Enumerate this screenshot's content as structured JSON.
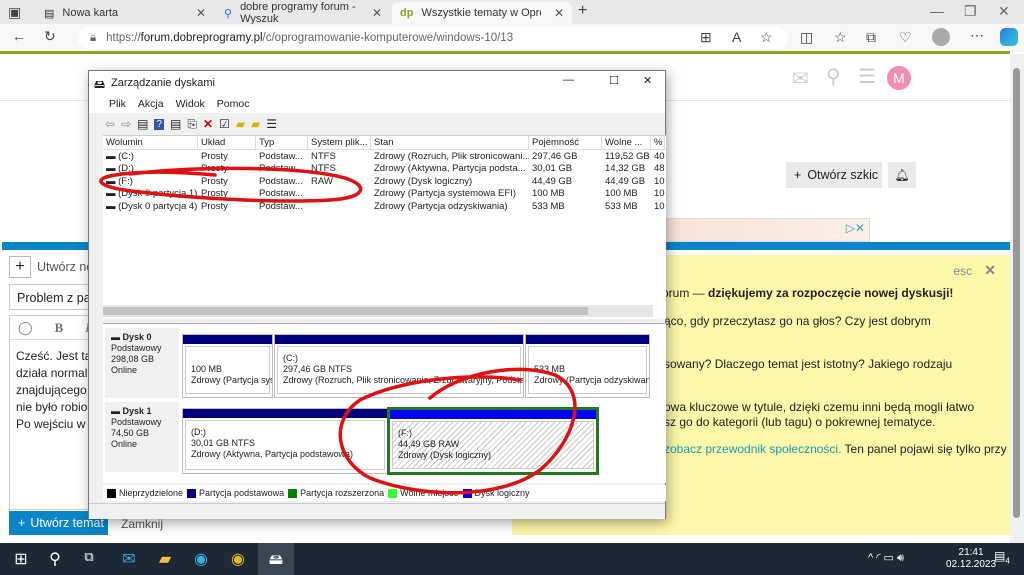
{
  "browser": {
    "tabs": [
      {
        "label": "Nowa karta",
        "icon": "newtab-icon"
      },
      {
        "label": "dobre programy forum - Wyszuk",
        "icon": "search-icon"
      },
      {
        "label": "Wszystkie tematy w Oprogramow",
        "icon": "dp-logo",
        "logo_text": "dp"
      }
    ],
    "url_prefix": "https://",
    "url_domain": "forum.dobreprogramy.pl",
    "url_path": "/c/oprogramowanie-komputerowe/windows-10/13",
    "accent": "#8fa41a"
  },
  "forum": {
    "avatar_letter": "M",
    "draft_button": "Otwórz szkic",
    "composer": {
      "new_topic_label": "Utwórz nowy",
      "title_value": "Problem z partyc",
      "body_lines": [
        "Cześć. Jest taki p",
        "działa normalnie,",
        "znajdującego się",
        "nie było robione.",
        "Po wejściu w zar"
      ],
      "create_button": "Utwórz temat",
      "close_button": "Zamknij"
    },
    "tips": {
      "esc": "esc",
      "line1_pre": "orum — ",
      "line1_bold": "dziękujemy za rozpoczęcie nowej dyskusji!",
      "line2": "ąco, gdy przeczytasz go na głos? Czy jest dobrym",
      "line3": "sowany? Dlaczego temat jest istotny? Jakiego rodzaju",
      "line4": "owa kluczowe w tytule, dzięki czemu inni będą mogli łatwo",
      "line5": "sz go do kategorii (lub tagu) o pokrewnej tematyce.",
      "line6_link": "zobacz przewodnik społeczności.",
      "line6_rest": " Ten panel pojawi się tylko przy",
      "bg": "#fcf8a9"
    }
  },
  "diskmgmt": {
    "title": "Zarządzanie dyskami",
    "menu": [
      "Plik",
      "Akcja",
      "Widok",
      "Pomoc"
    ],
    "columns": [
      "Wolumin",
      "Układ",
      "Typ",
      "System plik...",
      "Stan",
      "Pojemność",
      "Wolne ...",
      "%"
    ],
    "rows": [
      [
        "(C:)",
        "Prosty",
        "Podstaw...",
        "NTFS",
        "Zdrowy (Rozruch, Plik stronicowani...",
        "297,46 GB",
        "119,52 GB",
        "40"
      ],
      [
        "(D:)",
        "Prosty",
        "Podstaw...",
        "NTFS",
        "Zdrowy (Aktywna, Partycja podsta...",
        "30,01 GB",
        "14,32 GB",
        "48"
      ],
      [
        "(F:)",
        "Prosty",
        "Podstaw...",
        "RAW",
        "Zdrowy (Dysk logiczny)",
        "44,49 GB",
        "44,49 GB",
        "10"
      ],
      [
        "(Dysk 0 partycja 1)",
        "Prosty",
        "Podstaw...",
        "",
        "Zdrowy (Partycja systemowa EFI)",
        "100 MB",
        "100 MB",
        "10"
      ],
      [
        "(Dysk 0 partycja 4)",
        "Prosty",
        "Podstaw...",
        "",
        "Zdrowy (Partycja odzyskiwania)",
        "533 MB",
        "533 MB",
        "10"
      ]
    ],
    "disks": [
      {
        "name": "Dysk 0",
        "type": "Podstawowy",
        "size": "298,08 GB",
        "status": "Online",
        "parts": [
          {
            "l1": "",
            "l2": "100 MB",
            "l3": "Zdrowy (Partycja sys"
          },
          {
            "l1": "(C:)",
            "l2": "297,46 GB NTFS",
            "l3": "Zdrowy (Rozruch, Plik stronicowania, Zrzut awaryjny, Podsta"
          },
          {
            "l1": "",
            "l2": "533 MB",
            "l3": "Zdrowy (Partycja odzyskiwan"
          }
        ]
      },
      {
        "name": "Dysk 1",
        "type": "Podstawowy",
        "size": "74,50 GB",
        "status": "Online",
        "parts": [
          {
            "l1": "(D:)",
            "l2": "30,01 GB NTFS",
            "l3": "Zdrowy (Aktywna, Partycja podstawowa)"
          },
          {
            "l1": "(F:)",
            "l2": "44,49 GB RAW",
            "l3": "Zdrowy (Dysk logiczny)"
          }
        ]
      }
    ],
    "legend": [
      {
        "label": "Nieprzydzielone",
        "color": "#000000"
      },
      {
        "label": "Partycja podstawowa",
        "color": "#00007f"
      },
      {
        "label": "Partycja rozszerzona",
        "color": "#008000"
      },
      {
        "label": "Wolne miejsce",
        "color": "#33ff33"
      },
      {
        "label": "Dysk logiczny",
        "color": "#0000ff"
      }
    ]
  },
  "taskbar": {
    "time": "21:41",
    "date": "02.12.2023",
    "notifications": "4"
  }
}
